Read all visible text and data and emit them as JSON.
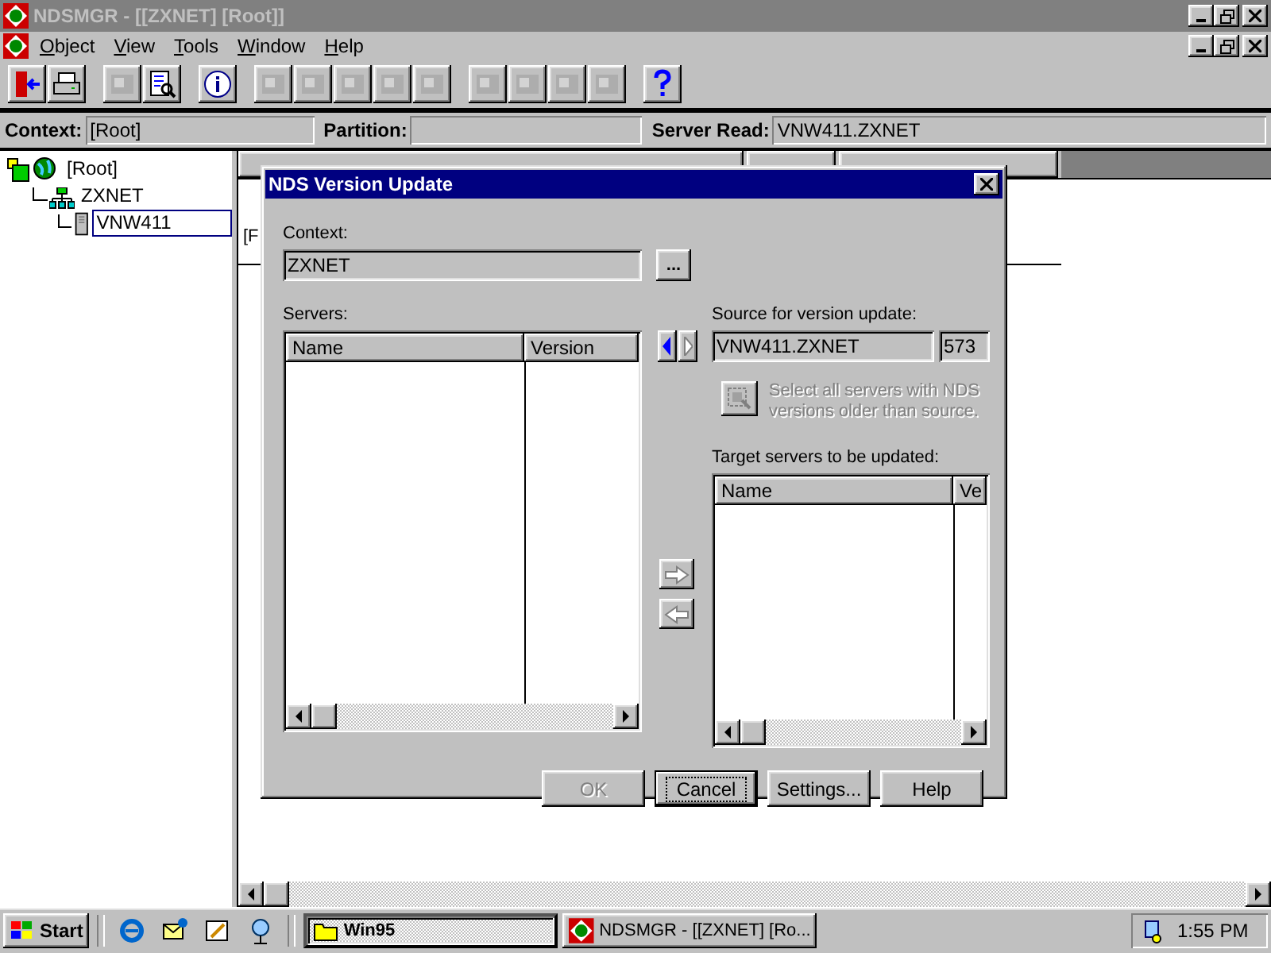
{
  "window": {
    "title": "NDSMGR - [[ZXNET] [Root]]"
  },
  "menu": [
    "Object",
    "View",
    "Tools",
    "Window",
    "Help"
  ],
  "toolbar": [
    [
      {
        "kind": "exit",
        "disabled": false
      },
      {
        "kind": "print",
        "disabled": false
      }
    ],
    [
      {
        "kind": "tool",
        "disabled": true
      },
      {
        "kind": "browse",
        "disabled": false
      }
    ],
    [
      {
        "kind": "info",
        "disabled": false
      }
    ],
    [
      {
        "kind": "tool",
        "disabled": true
      },
      {
        "kind": "tool",
        "disabled": true
      },
      {
        "kind": "tool",
        "disabled": true
      },
      {
        "kind": "tool",
        "disabled": true
      },
      {
        "kind": "tool",
        "disabled": true
      }
    ],
    [
      {
        "kind": "tool",
        "disabled": true
      },
      {
        "kind": "tool",
        "disabled": true
      },
      {
        "kind": "tool",
        "disabled": true
      },
      {
        "kind": "tool",
        "disabled": true
      }
    ],
    [
      {
        "kind": "help",
        "disabled": false
      }
    ]
  ],
  "context_bar": [
    {
      "label": "Context:",
      "value": "[Root]"
    },
    {
      "label": "Partition:"
    },
    {
      "label": "Server Read:",
      "value": "VNW411.ZXNET"
    }
  ],
  "tree": [
    {
      "label": "[Root]",
      "kind": "root",
      "selected": false,
      "children": [
        {
          "label": "ZXNET",
          "kind": "org",
          "selected": false,
          "children": [
            {
              "label": "VNW411",
              "kind": "server",
              "selected": true
            }
          ]
        }
      ]
    }
  ],
  "right_pane": {
    "cell": "[F"
  },
  "dialog": {
    "title": "NDS Version Update",
    "context_label": "Context:",
    "context_value": "ZXNET",
    "browse_button": "...",
    "servers_label": "Servers:",
    "servers_columns": [
      "Name",
      "Version"
    ],
    "source_arrows": [
      {
        "kind": "left",
        "disabled": false
      },
      {
        "kind": "right",
        "disabled": true
      }
    ],
    "source_label": "Source for version update:",
    "source_value": "VNW411.ZXNET",
    "source_version": "573",
    "select_all": {
      "text": "Select all servers with NDS versions older than source.",
      "disabled": true
    },
    "move_buttons": [
      {
        "kind": "right",
        "disabled": true
      },
      {
        "kind": "left",
        "disabled": true
      }
    ],
    "target_label": "Target servers to be updated:",
    "target_columns": [
      "Name",
      "Ve"
    ],
    "buttons": [
      {
        "label": "OK",
        "disabled": true,
        "default": false
      },
      {
        "label": "Cancel",
        "disabled": false,
        "default": true
      },
      {
        "label": "Settings...",
        "disabled": false,
        "default": false
      },
      {
        "label": "Help",
        "disabled": false,
        "default": false
      }
    ]
  },
  "taskbar": {
    "start": "Start",
    "tasks": [
      {
        "label": "Win95",
        "selected": true
      },
      {
        "label": "NDSMGR - [[ZXNET] [Ro...",
        "selected": false
      }
    ],
    "clock": "1:55 PM"
  }
}
